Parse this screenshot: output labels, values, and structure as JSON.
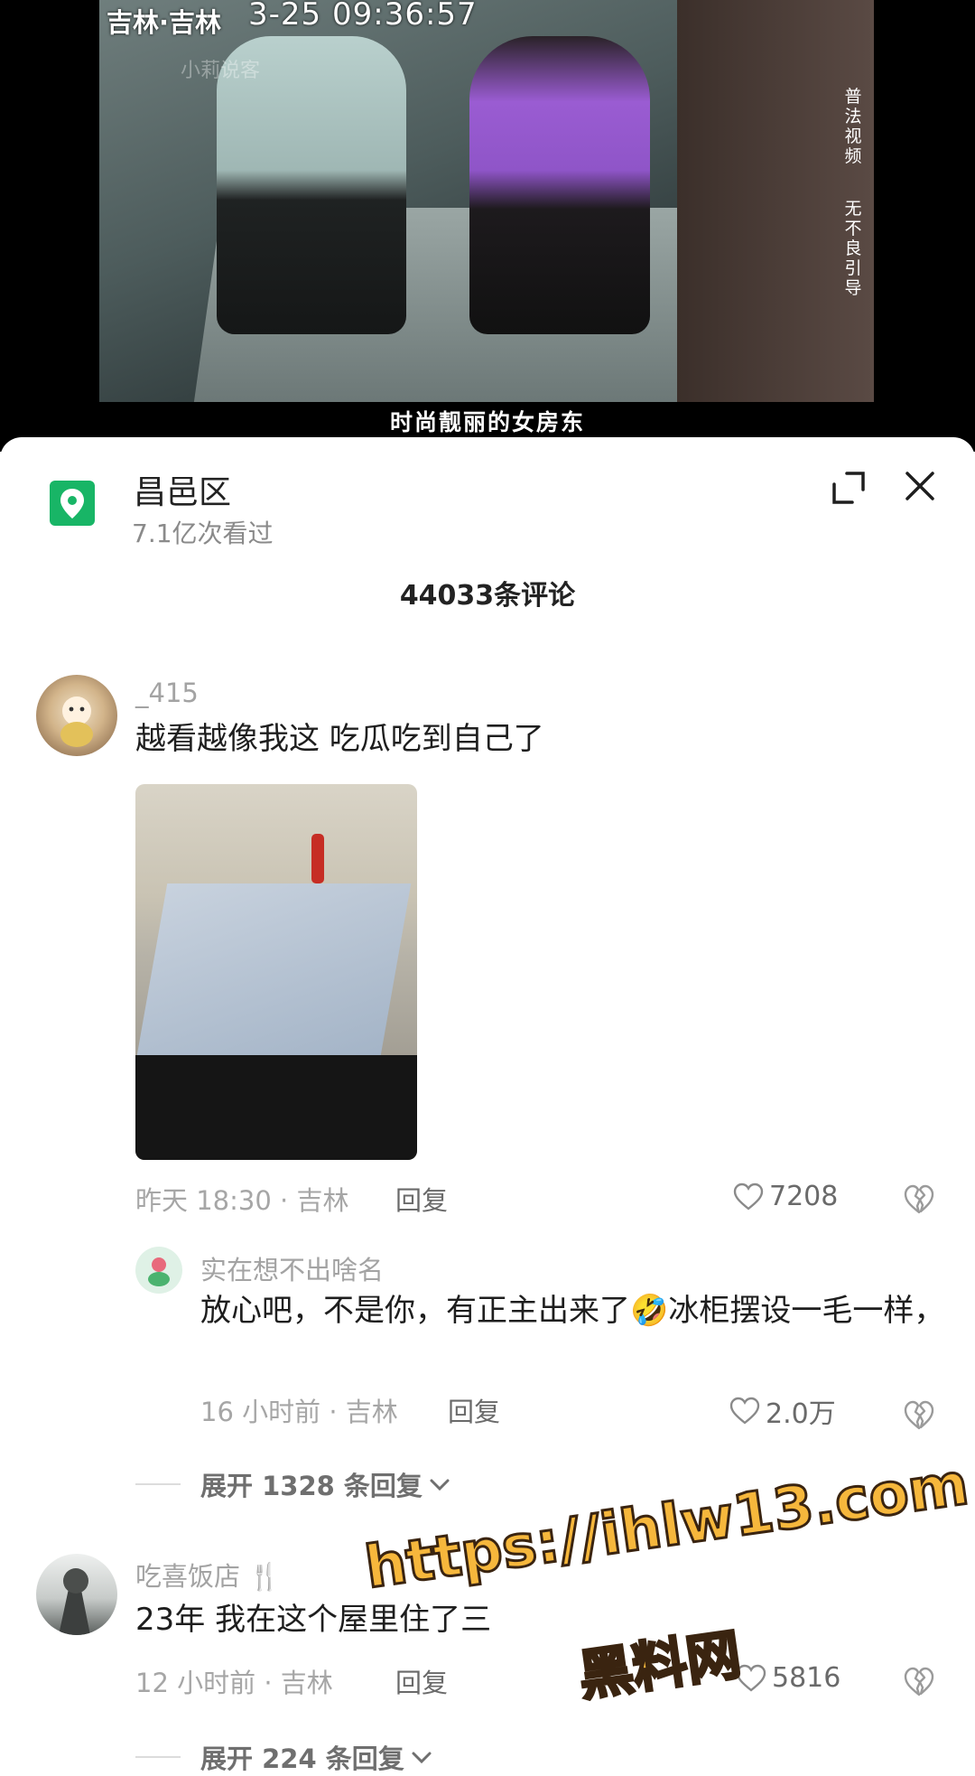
{
  "video": {
    "timestamp_location": "吉林·吉林",
    "timestamp_time": "3-25 09:36:57",
    "faint_watermark": "小莉说客",
    "side_text_1": "普法视频",
    "side_text_2": "无不良引导",
    "caption": "时尚靓丽的女房东"
  },
  "header": {
    "location_name": "昌邑区",
    "views": "7.1亿次看过",
    "comment_count": "44033条评论"
  },
  "comments": [
    {
      "username": "_415",
      "text": "越看越像我这 吃瓜吃到自己了",
      "meta": "昨天 18:30 · 吉林",
      "reply_label": "回复",
      "likes": "7208",
      "replies": [
        {
          "username": "实在想不出啥名",
          "text": "放心吧，不是你，有正主出来了🤣冰柜摆设一毛一样，",
          "meta": "16 小时前 · 吉林",
          "reply_label": "回复",
          "likes": "2.0万"
        }
      ],
      "expand_label": "展开 1328 条回复"
    },
    {
      "username": "吃喜饭店 🍴",
      "text": "23年   我在这个屋里住了三",
      "meta": "12 小时前 · 吉林",
      "reply_label": "回复",
      "likes": "5816",
      "expand_label": "展开 224 条回复"
    }
  ],
  "overlay_watermark": {
    "line1": "https://ihlw13.com",
    "line2": "黑料网"
  },
  "colors": {
    "location_icon": "#18b566",
    "meta_gray": "#a6a6a6"
  }
}
